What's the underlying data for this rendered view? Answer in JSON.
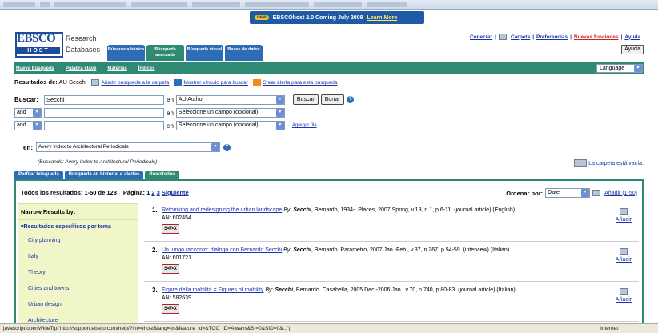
{
  "promo": {
    "badge": "new",
    "text": "EBSCOhost 2.0   Coming July 2008",
    "link": "Learn More"
  },
  "logo": {
    "ebsco": "EBSCO",
    "host": "HOST",
    "research": "Research",
    "databases": "Databases"
  },
  "top_tabs": [
    {
      "label": "Búsqueda básica"
    },
    {
      "label": "Búsqueda avanzada"
    },
    {
      "label": "Búsqueda visual"
    },
    {
      "label": "Bases de datos"
    }
  ],
  "top_links": {
    "conectar": "Conectar",
    "sep": "|",
    "carpeta": "Carpeta",
    "preferencias": "Preferencias",
    "nuevas": "Nuevas funciones",
    "ayuda": "Ayuda"
  },
  "ayuda_button": "Ayuda",
  "greenbar": {
    "nueva": "Nueva búsqueda",
    "palabra": "Palabra clave",
    "materias": "Materias",
    "indices": "Índices",
    "language": "Language"
  },
  "results_for": {
    "label": "Resultados de:",
    "query": "AU Secchi",
    "add": "Añadir búsqueda a la carpeta",
    "link": "Mostrar vínculo para buscar",
    "alert": "Crear alerta para esta búsqueda"
  },
  "search": {
    "buscar_label": "Buscar:",
    "row1_value": "Secchi",
    "en": "en",
    "row1_field": "AU Author",
    "buscar_btn": "Buscar",
    "borrar_btn": "Borrar",
    "and": "and",
    "row_field_placeholder": "Seleccione un campo (opcional)",
    "agregar": "Agregar fila"
  },
  "database": {
    "en": "en:",
    "value": "Avery Index to Architectural Periodicals",
    "buscando": "(Buscando:  Avery Index to Architectural Periodicals)"
  },
  "carpeta_vacia": "La carpeta está vacía.",
  "sub_tabs": [
    {
      "label": "Perfilar búsqueda"
    },
    {
      "label": "Búsqueda en historial e alertas"
    },
    {
      "label": "Resultados"
    }
  ],
  "summary": {
    "todos": "Todos los resultados: 1-50 de 128",
    "pagina": "Página: 1",
    "p2": "2",
    "p3": "3",
    "siguiente": "Siguiente"
  },
  "orden": {
    "label": "Ordenar por:",
    "value": "Date",
    "add": "Añadir (1-50)"
  },
  "sidebar": {
    "narrow": "Narrow Results by:",
    "subject": "▾Resultados específicos por tema",
    "items": [
      "City planning",
      "Italy",
      "Theory",
      "Cities and towns",
      "Urban design",
      "Architecture"
    ]
  },
  "results": [
    {
      "num": "1.",
      "title": "Rethinking and redesigning the urban landscape",
      "by": "By:",
      "author": "Secchi",
      "rest": ", Bernardo, 1934-. Places, 2007 Spring, v.19, n.1, p.6-11. (journal article) (English)",
      "an": "AN: 602454",
      "sfx": "S•F•X",
      "add": "Añadir"
    },
    {
      "num": "2.",
      "title": "Un lungo racconto: dialogo con Bernardo Secchi",
      "by": "By:",
      "author": "Secchi",
      "rest": ", Bernardo. Parametro, 2007 Jan.-Feb., v.37, n.267, p.54-59. (interview) (Italian)",
      "an": "AN: 601721",
      "sfx": "S•F•X",
      "add": "Añadir"
    },
    {
      "num": "3.",
      "title": "Figure della mobilità = Figures of mobility",
      "by": "By:",
      "author": "Secchi",
      "rest": ", Bernardo. Casabella, 2005 Dec.-2006 Jan., v.70, n.740, p.80-83. (journal article) (Italian)",
      "an": "AN: 582639",
      "sfx": "S•F•X",
      "add": "Añadir"
    }
  ],
  "status": {
    "url": "javascript:openWideTip('http://support.ebsco.com/help/?int=ehost&lang=es&feature_id=&TOC_ID=Always&SI=0&SID=0&...')",
    "zone": "Internet"
  }
}
